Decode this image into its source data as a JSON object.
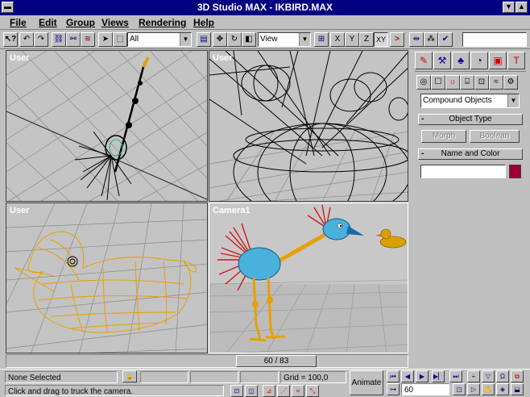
{
  "window": {
    "title": "3D Studio MAX - IKBIRD.MAX",
    "min_glyph": "▼",
    "max_glyph": "▲",
    "sys_glyph": "▬"
  },
  "menu": {
    "items": [
      "File",
      "Edit",
      "Group",
      "Views",
      "Rendering",
      "Help"
    ]
  },
  "toolbar": {
    "selection_filter": "All",
    "coord_system": "View",
    "axis_x": "X",
    "axis_y": "Y",
    "axis_z": "Z",
    "axis_xy": "XY"
  },
  "viewports": {
    "top_left": {
      "label": "User"
    },
    "top_right": {
      "label": "User"
    },
    "bottom_left": {
      "label": "User"
    },
    "bottom_right": {
      "label": "Camera1"
    }
  },
  "frame_slider": {
    "label": "60 / 83",
    "current": 60,
    "total": 83
  },
  "command_panel": {
    "category_dropdown": "Compound Objects",
    "object_type": {
      "title": "Object Type",
      "toggle": "-",
      "buttons": [
        "Morph",
        "Boolean"
      ]
    },
    "name_and_color": {
      "title": "Name and Color",
      "toggle": "-",
      "name_value": "",
      "color": "#9c0030"
    }
  },
  "status": {
    "selection": "None Selected",
    "prompt": "Click and drag to truck the camera.",
    "grid": "Grid = 100,0",
    "animate": "Animate",
    "frame_field": "60"
  },
  "colors": {
    "title_bar": "#000080",
    "viewport_bg": "#c4c4c4",
    "wire_bird": "#e8a000",
    "swatch": "#9c0030"
  }
}
